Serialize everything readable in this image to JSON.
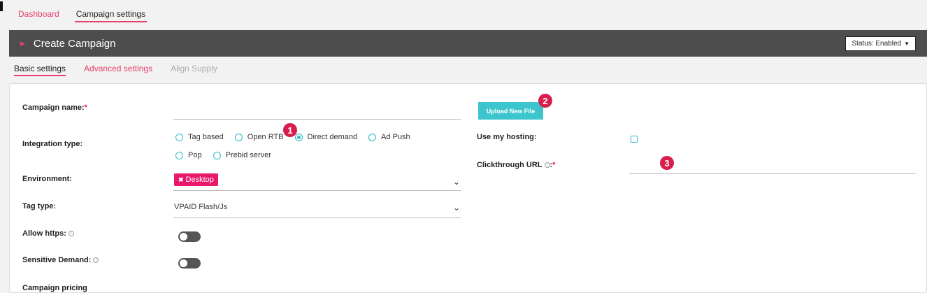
{
  "nav": {
    "dashboard": "Dashboard",
    "campaign_settings": "Campaign settings"
  },
  "header": {
    "title": "Create Campaign",
    "status_label": "Status: Enabled",
    "arrow_icon": "play-arrow-icon"
  },
  "subtabs": {
    "basic": "Basic settings",
    "advanced": "Advanced settings",
    "align_supply": "Align Supply"
  },
  "form": {
    "campaign_name_label": "Campaign name:",
    "campaign_name_value": "",
    "integration_type_label": "Integration type:",
    "integration_options": [
      "Tag based",
      "Open RTB",
      "Direct demand",
      "Ad Push",
      "Pop",
      "Prebid server"
    ],
    "integration_selected": "Direct demand",
    "environment_label": "Environment:",
    "environment_chip": "Desktop",
    "tag_type_label": "Tag type:",
    "tag_type_value": "VPAID Flash/Js",
    "allow_https_label": "Allow https:",
    "sensitive_demand_label": "Sensitive Demand:",
    "campaign_pricing_label": "Campaign pricing",
    "required_mark": "*"
  },
  "right": {
    "upload_button": "Upload New File",
    "use_hosting_label": "Use my hosting:",
    "clickthrough_label": "Clickthrough URL",
    "clickthrough_value": ""
  },
  "badges": {
    "one": "1",
    "two": "2",
    "three": "3"
  },
  "colors": {
    "accent_pink": "#e83e6c",
    "teal": "#3cc5cc",
    "header_bg": "#4d4d4d",
    "badge": "#d81e4c"
  }
}
